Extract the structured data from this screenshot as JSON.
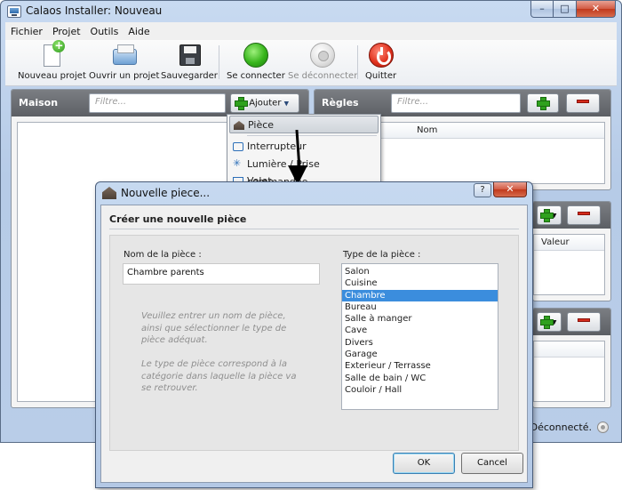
{
  "window": {
    "title": "Calaos Installer: Nouveau"
  },
  "menu": [
    "Fichier",
    "Projet",
    "Outils",
    "Aide"
  ],
  "toolbar": {
    "new_project": "Nouveau projet",
    "open_project": "Ouvrir un projet",
    "save": "Sauvegarder",
    "connect": "Se connecter",
    "disconnect": "Se déconnecter",
    "quit": "Quitter"
  },
  "maison_panel": {
    "title": "Maison",
    "filter_placeholder": "Filtre...",
    "add_label": "Ajouter"
  },
  "regles_panel": {
    "title": "Règles",
    "filter_placeholder": "Filtre...",
    "column_nom": "Nom",
    "column_valeur": "Valeur"
  },
  "add_menu": {
    "items": [
      "Pièce",
      "Interrupteur",
      "Lumière / Prise commandée",
      "Volet"
    ]
  },
  "dialog": {
    "title": "Nouvelle piece...",
    "help_button": "?",
    "heading": "Créer une nouvelle pièce",
    "name_label": "Nom de la pièce :",
    "name_value": "Chambre parents",
    "type_label": "Type de la pièce :",
    "help_text": "Veuillez entrer un nom de pièce, ainsi que sélectionner le type de pièce adéquat.\n\nLe type de pièce correspond à la catégorie dans laquelle la pièce va se retrouver.",
    "room_types": [
      "Salon",
      "Cuisine",
      "Chambre",
      "Bureau",
      "Salle à manger",
      "Cave",
      "Divers",
      "Garage",
      "Exterieur / Terrasse",
      "Salle de bain / WC",
      "Couloir / Hall"
    ],
    "selected_type": "Chambre",
    "ok": "OK",
    "cancel": "Cancel"
  },
  "status": {
    "text": "Déconnecté."
  }
}
